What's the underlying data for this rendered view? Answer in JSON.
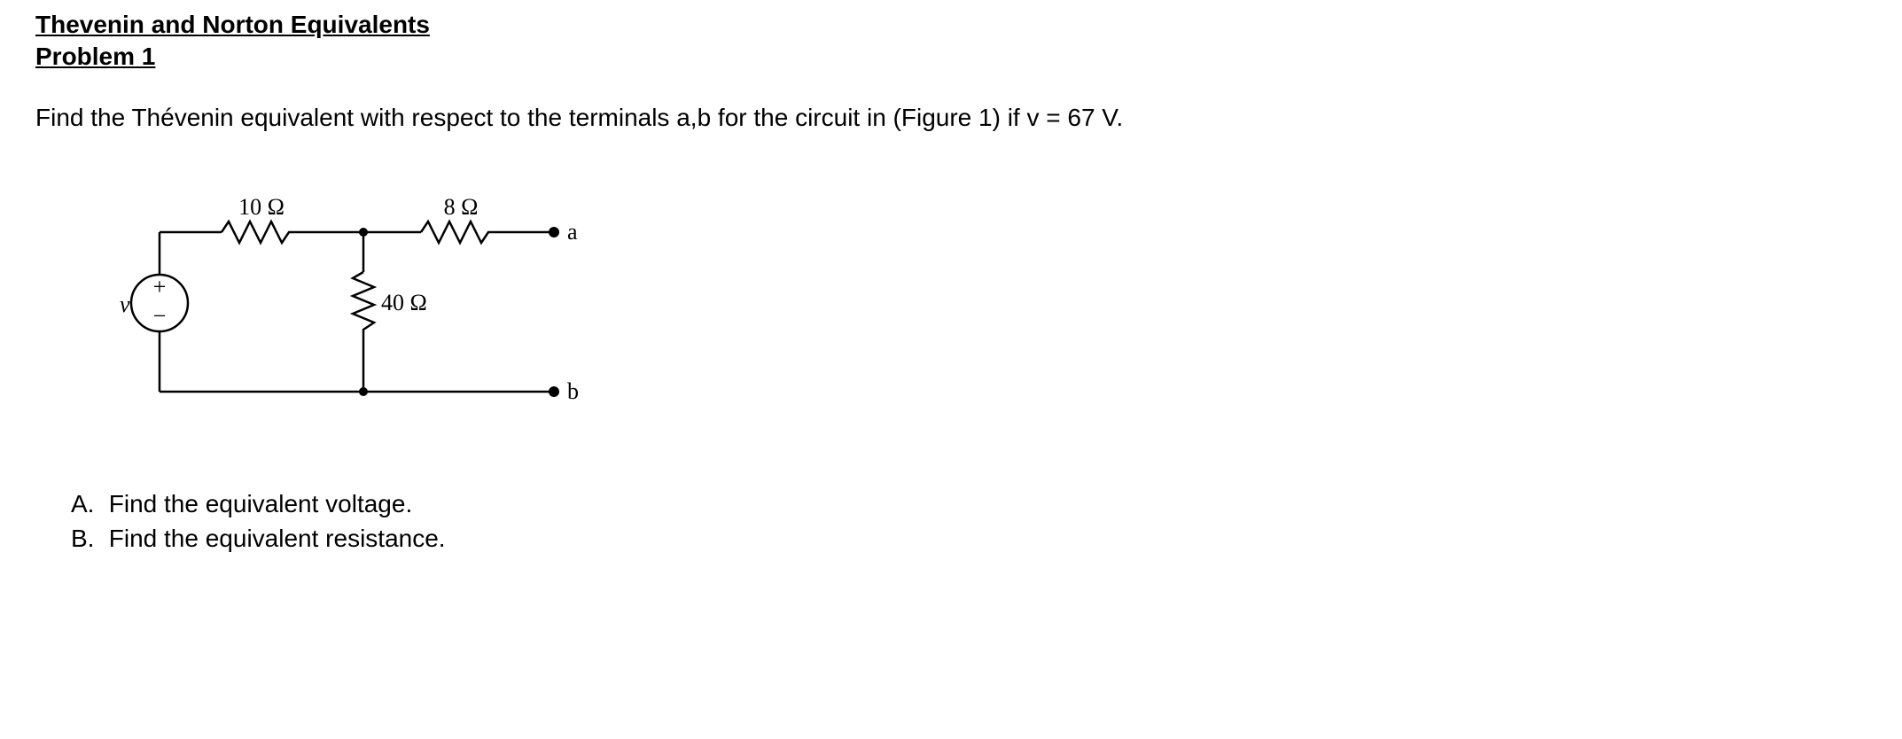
{
  "heading": {
    "title": "Thevenin and Norton Equivalents",
    "subtitle": "Problem 1"
  },
  "statement": "Find the Thévenin equivalent with respect to the terminals a,b for the circuit in (Figure 1) if v = 67 V.",
  "circuit": {
    "r1_label": "10 Ω",
    "r2_label": "8 Ω",
    "r3_label": "40 Ω",
    "source_label": "v",
    "source_plus": "+",
    "source_minus": "−",
    "terminal_a": "a",
    "terminal_b": "b"
  },
  "questions": {
    "a": {
      "marker": "A.",
      "text": "Find the equivalent voltage."
    },
    "b": {
      "marker": "B.",
      "text": "Find the equivalent resistance."
    }
  }
}
